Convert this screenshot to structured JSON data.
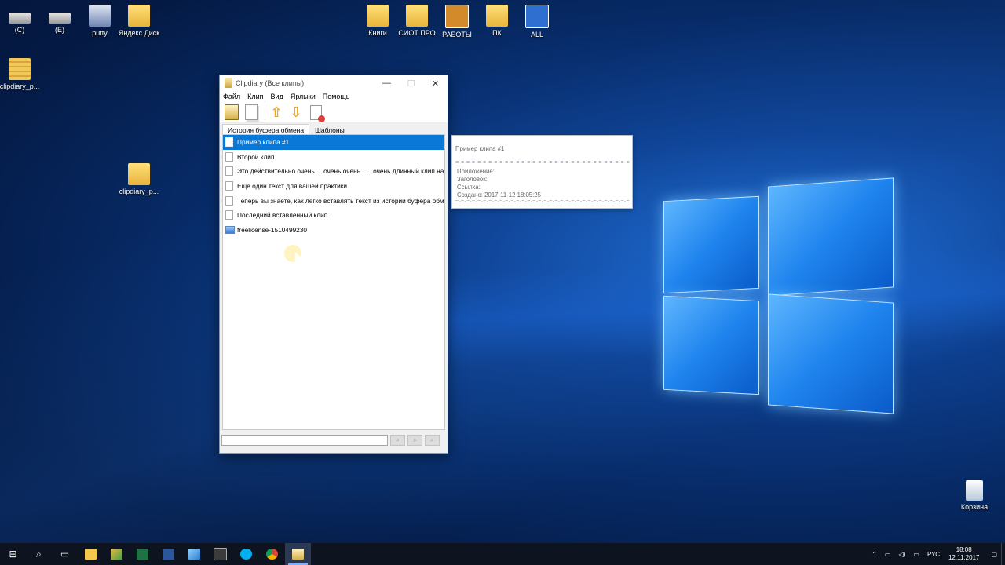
{
  "desktop": {
    "icons_left": [
      {
        "label": "(C)",
        "icon": "drive-c-icon"
      },
      {
        "label": "(E)",
        "icon": "drive-e-icon"
      },
      {
        "label": "putty",
        "icon": "putty-icon"
      },
      {
        "label": "Яндекс.Диск",
        "icon": "yandex-disk-folder-icon"
      },
      {
        "label": "clipdiary_p...",
        "icon": "zip-archive-icon"
      },
      {
        "label": "clipdiary_p...",
        "icon": "folder-icon"
      }
    ],
    "icons_top": [
      {
        "label": "Книги",
        "icon": "books-folder-icon"
      },
      {
        "label": "СИОТ ПРО",
        "icon": "folder-icon"
      },
      {
        "label": "РАБОТЫ",
        "icon": "key-icon"
      },
      {
        "label": "ПК",
        "icon": "users-folder-icon"
      },
      {
        "label": "ALL",
        "icon": "network-icon"
      }
    ],
    "recycle_bin": {
      "label": "Корзина",
      "icon": "recycle-bin-icon"
    }
  },
  "window": {
    "title": "Clipdiary (Все клипы)",
    "controls": {
      "minimize": "—",
      "maximize": "☐",
      "close": "✕"
    },
    "menu": [
      "Файл",
      "Клип",
      "Вид",
      "Ярлыки",
      "Помощь"
    ],
    "toolbar_icons": [
      "paste-icon",
      "copy-icon",
      "move-up-icon",
      "move-down-icon",
      "delete-icon"
    ],
    "tabs": [
      {
        "label": "История буфера обмена",
        "active": true
      },
      {
        "label": "Шаблоны",
        "active": false
      }
    ],
    "clips": [
      {
        "text": "Пример клипа #1",
        "type": "text",
        "selected": true
      },
      {
        "text": "Второй клип",
        "type": "text",
        "selected": false
      },
      {
        "text": "Это действительно очень ... очень очень... ...очень длинный клип на не...",
        "type": "text",
        "selected": false
      },
      {
        "text": "Еще один текст для вашей практики",
        "type": "text",
        "selected": false
      },
      {
        "text": "Теперь вы знаете, как легко вставлять текст из истории буфера обмена,",
        "type": "text",
        "selected": false
      },
      {
        "text": "Последний вставленный клип",
        "type": "text",
        "selected": false
      },
      {
        "text": "freelicense-1510499230",
        "type": "image",
        "selected": false
      }
    ],
    "search": {
      "value": "",
      "placeholder": ""
    },
    "search_buttons": [
      "search-icon",
      "search-prev-icon",
      "search-next-icon"
    ]
  },
  "tooltip": {
    "title": "Пример клипа #1",
    "dashes": "=-=-=-=-=-=-=-=-=-=-=-=-=-=-=-=-=-=-=-=-=-=-=-=-=-=-=-=-=-=-=-=-=",
    "app": "Приложение:",
    "header": "Заголовок:",
    "link": "Ссылка:",
    "created": "Создано: 2017-11-12 18:05:25"
  },
  "taskbar": {
    "items": [
      "start-icon",
      "search-icon",
      "task-view-icon",
      "file-explorer-icon",
      "paint-icon",
      "excel-icon",
      "word-icon",
      "notepad-icon",
      "calculator-icon",
      "skype-icon",
      "chrome-icon",
      "clipdiary-icon"
    ],
    "tray": {
      "language": "РУС",
      "time": "18:08",
      "date": "12.11.2017"
    }
  },
  "colors": {
    "selection": "#0a78d7",
    "taskbar": "#0d1420"
  }
}
